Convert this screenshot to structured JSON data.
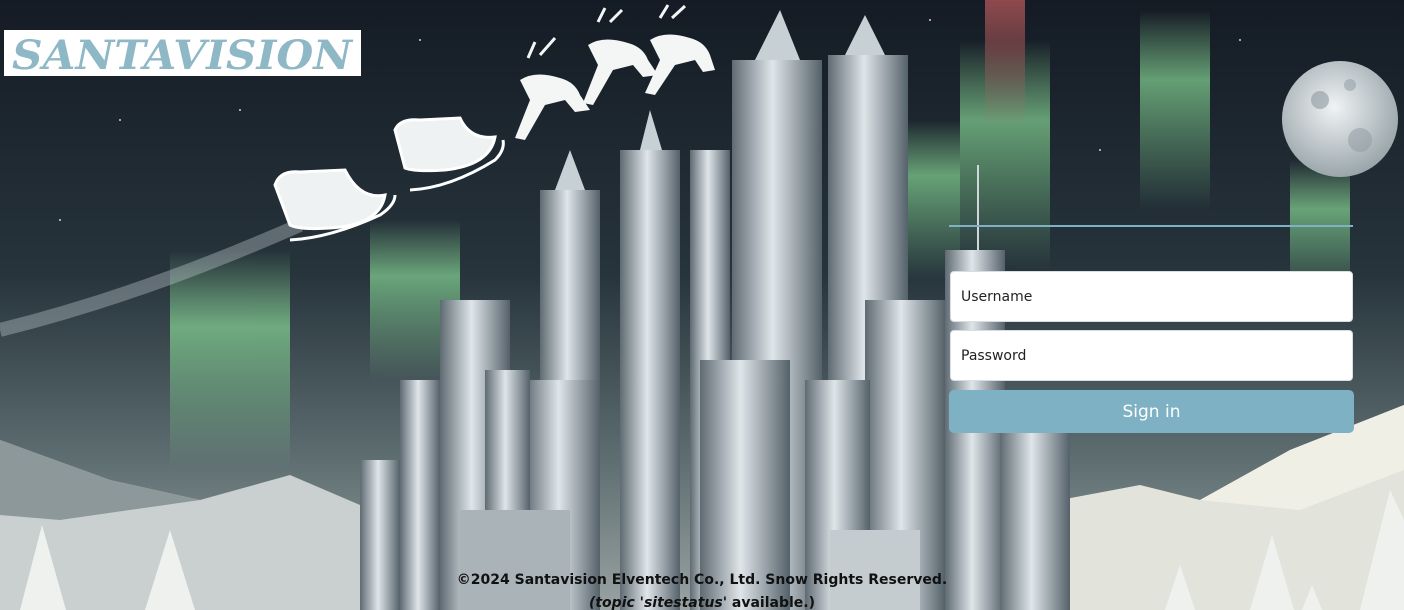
{
  "brand": {
    "logo_text": "SANTAVISION",
    "logo_color": "#8fb8c6"
  },
  "login": {
    "username_placeholder": "Username",
    "password_placeholder": "Password",
    "signin_label": "Sign in",
    "accent": "#7fb1c4"
  },
  "footer": {
    "copyright": "©2024 Santavision Elventech Co., Ltd. Snow Rights Reserved.",
    "status_prefix": "(topic 'sitestatus'",
    "status_suffix": " available.)"
  },
  "scene": {
    "description_icons": [
      "moon-icon",
      "sleigh-icon",
      "reindeer-icon",
      "aurora",
      "city-towers",
      "mountains",
      "pine-trees"
    ]
  }
}
